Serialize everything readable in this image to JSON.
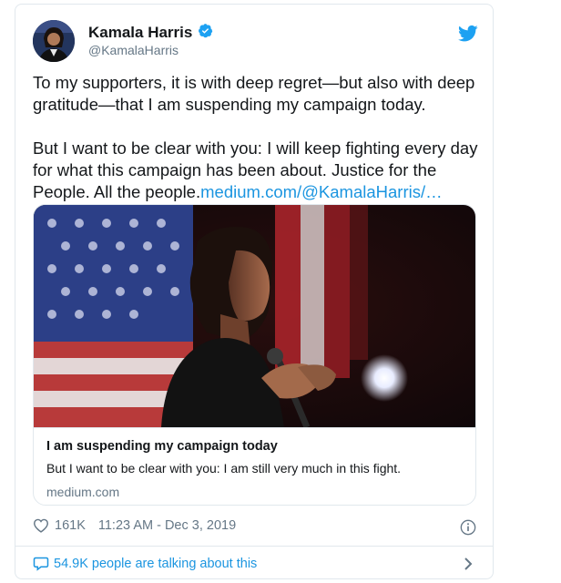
{
  "tweet": {
    "author_name": "Kamala Harris",
    "author_handle": "@KamalaHarris",
    "text_p1": "To my supporters, it is with deep regret—but also with deep gratitude—that I am suspending my campaign today.",
    "text_p2_prefix": "But I want to be clear with you: I will keep fighting every day for what this campaign has been about. Justice for the People. All the people.",
    "text_link": "medium.com/@KamalaHarris/…",
    "likes": "161K",
    "timestamp": "11:23 AM - Dec 3, 2019",
    "talking": "54.9K people are talking about this"
  },
  "card": {
    "title": "I am suspending my campaign today",
    "description": "But I want to be clear with you: I am still very much in this fight.",
    "domain": "medium.com"
  },
  "colors": {
    "link": "#1b95e0",
    "muted": "#657786",
    "border": "#e1e8ed",
    "verified": "#1da1f2"
  },
  "icons": [
    "verified-badge-icon",
    "twitter-bird-icon",
    "heart-icon",
    "info-icon",
    "comment-bubble-icon",
    "chevron-right-icon"
  ]
}
